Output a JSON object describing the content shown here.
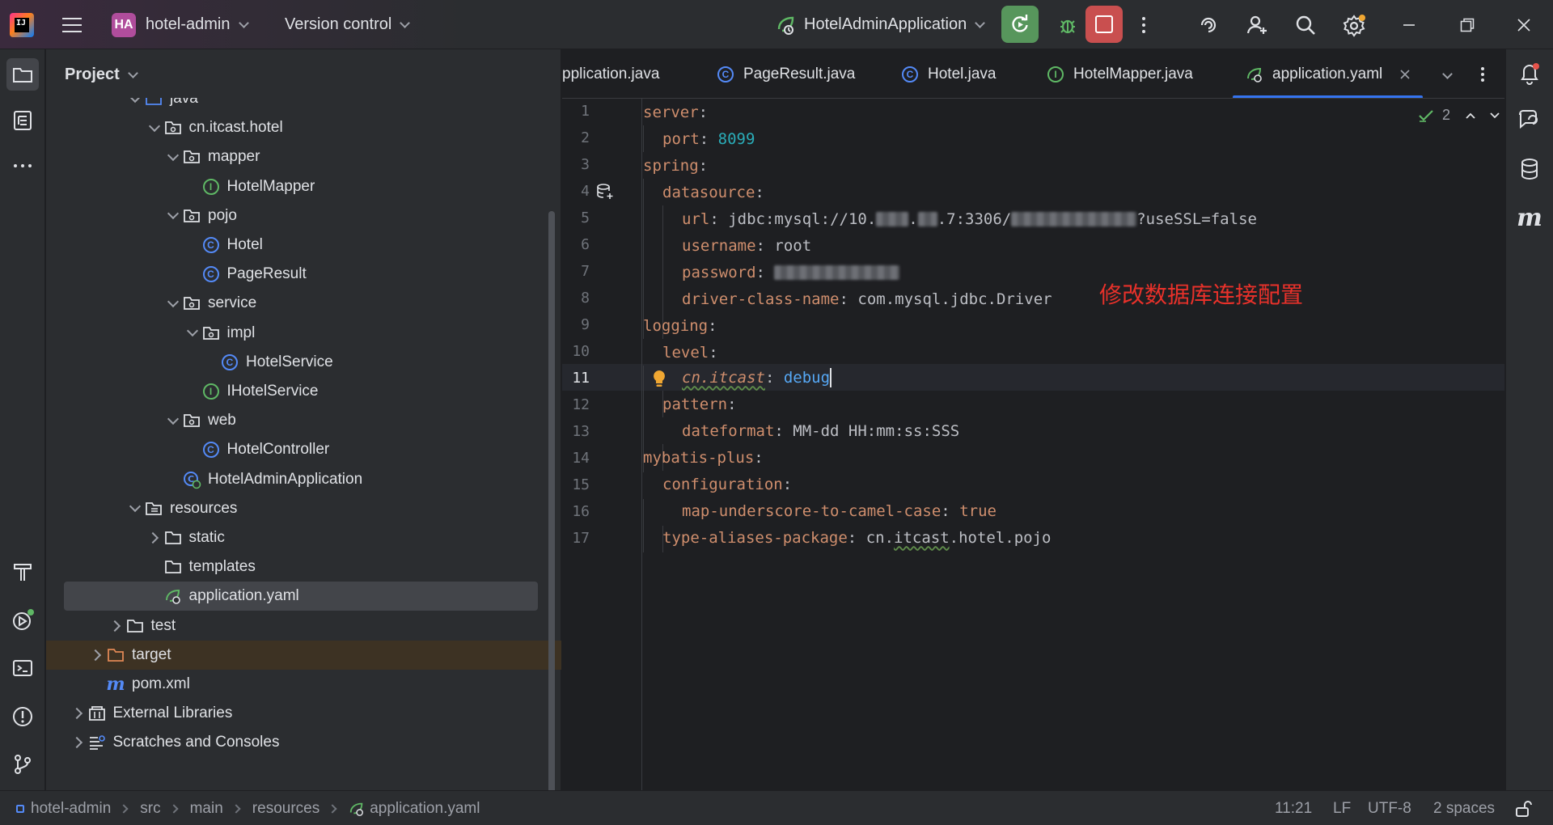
{
  "titlebar": {
    "project_initials": "HA",
    "project_name": "hotel-admin",
    "vcs_label": "Version control",
    "run_config": "HotelAdminApplication"
  },
  "project_panel": {
    "title": "Project",
    "tree": [
      {
        "label": "java",
        "depth": 4,
        "expand": "down",
        "icon": "source-folder-icon"
      },
      {
        "label": "cn.itcast.hotel",
        "depth": 5,
        "expand": "down",
        "icon": "package-icon"
      },
      {
        "label": "mapper",
        "depth": 6,
        "expand": "down",
        "icon": "package-icon"
      },
      {
        "label": "HotelMapper",
        "depth": 7,
        "expand": "none",
        "icon": "interface-icon"
      },
      {
        "label": "pojo",
        "depth": 6,
        "expand": "down",
        "icon": "package-icon"
      },
      {
        "label": "Hotel",
        "depth": 7,
        "expand": "none",
        "icon": "class-icon"
      },
      {
        "label": "PageResult",
        "depth": 7,
        "expand": "none",
        "icon": "class-icon"
      },
      {
        "label": "service",
        "depth": 6,
        "expand": "down",
        "icon": "package-icon"
      },
      {
        "label": "impl",
        "depth": 7,
        "expand": "down",
        "icon": "package-icon"
      },
      {
        "label": "HotelService",
        "depth": 8,
        "expand": "none",
        "icon": "class-icon"
      },
      {
        "label": "IHotelService",
        "depth": 7,
        "expand": "none",
        "icon": "interface-icon"
      },
      {
        "label": "web",
        "depth": 6,
        "expand": "down",
        "icon": "package-icon"
      },
      {
        "label": "HotelController",
        "depth": 7,
        "expand": "none",
        "icon": "class-icon"
      },
      {
        "label": "HotelAdminApplication",
        "depth": 6,
        "expand": "none",
        "icon": "spring-class-icon"
      },
      {
        "label": "resources",
        "depth": 4,
        "expand": "down",
        "icon": "resources-folder-icon"
      },
      {
        "label": "static",
        "depth": 5,
        "expand": "right",
        "icon": "folder-icon"
      },
      {
        "label": "templates",
        "depth": 5,
        "expand": "none",
        "icon": "folder-icon"
      },
      {
        "label": "application.yaml",
        "depth": 5,
        "expand": "none",
        "icon": "yaml-spring-icon",
        "selected": true
      },
      {
        "label": "test",
        "depth": 3,
        "expand": "right",
        "icon": "folder-icon"
      },
      {
        "label": "target",
        "depth": 2,
        "expand": "right",
        "icon": "excluded-folder-icon",
        "excluded": true
      },
      {
        "label": "pom.xml",
        "depth": 2,
        "expand": "none",
        "icon": "maven-icon"
      },
      {
        "label": "External Libraries",
        "depth": 1,
        "expand": "right",
        "icon": "libraries-icon"
      },
      {
        "label": "Scratches and Consoles",
        "depth": 1,
        "expand": "right",
        "icon": "scratches-icon"
      }
    ]
  },
  "tabs": [
    {
      "label": "pplication.java",
      "icon": "none"
    },
    {
      "label": "PageResult.java",
      "icon": "class-icon"
    },
    {
      "label": "Hotel.java",
      "icon": "class-icon"
    },
    {
      "label": "HotelMapper.java",
      "icon": "interface-icon"
    },
    {
      "label": "application.yaml",
      "icon": "yaml-spring-icon",
      "active": true
    }
  ],
  "editor": {
    "inspection_count": "2",
    "annotation": "修改数据库连接配置",
    "lines": [
      "1",
      "2",
      "3",
      "4",
      "5",
      "6",
      "7",
      "8",
      "9",
      "10",
      "11",
      "12",
      "13",
      "14",
      "15",
      "16",
      "17"
    ],
    "current_line": "11",
    "code": {
      "l1_key": "server",
      "colon": ":",
      "l2_key": "port",
      "l2_val": "8099",
      "l3_key": "spring",
      "l4_key": "datasource",
      "l5_key": "url",
      "l5_val_a": "jdbc:mysql://10.",
      "l5_val_b": ".7:3306/",
      "l5_val_c": "?useSSL=false",
      "l6_key": "username",
      "l6_val": "root",
      "l7_key": "password",
      "l8_key": "driver-class-name",
      "l8_val": "com.mysql.jdbc.Driver",
      "l9_key": "logging",
      "l10_key": "level",
      "l11_key": "cn.itcast",
      "l11_val": "debug",
      "l12_key": "pattern",
      "l13_key": "dateformat",
      "l13_val": "MM-dd HH:mm:ss:SSS",
      "l14_key": "mybatis-plus",
      "l15_key": "configuration",
      "l16_key": "map-underscore-to-camel-case",
      "l16_val": "true",
      "l17_key": "type-aliases-package",
      "l17_val_a": "cn.",
      "l17_val_b": "itcast",
      "l17_val_c": ".hotel.pojo"
    }
  },
  "statusbar": {
    "crumbs": [
      "hotel-admin",
      "src",
      "main",
      "resources",
      "application.yaml"
    ],
    "position": "11:21",
    "line_sep": "LF",
    "encoding": "UTF-8",
    "indent": "2 spaces"
  },
  "colors": {
    "accent": "#3574f0",
    "run": "#57965c",
    "stop": "#c94f4f",
    "annotation": "#e8312a",
    "yaml_key": "#cf8e6d",
    "number": "#2aacb8"
  }
}
